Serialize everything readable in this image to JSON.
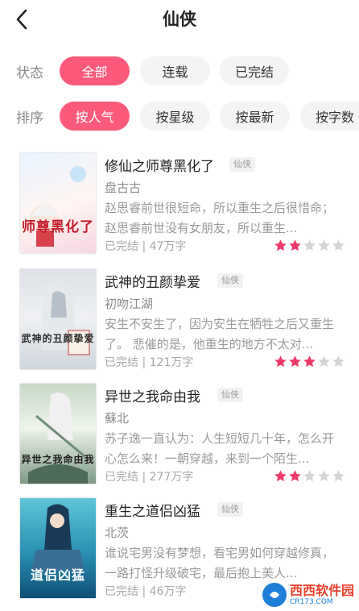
{
  "header": {
    "title": "仙侠"
  },
  "filters": {
    "status_label": "状态",
    "status_options": [
      "全部",
      "连载",
      "已完结"
    ],
    "sort_label": "排序",
    "sort_options": [
      "按人气",
      "按星级",
      "按最新",
      "按字数"
    ]
  },
  "books": [
    {
      "title": "修仙之师尊黑化了",
      "tag": "仙侠",
      "author": "盘古古",
      "description": "赵思睿前世很短命，所以重生之后很惜命；赵思睿前世没有女朋友，所以重生...",
      "status": "已完结",
      "word_count": "47万字",
      "rating": 2,
      "cover_text": "师尊黑化了"
    },
    {
      "title": "武神的丑颜挚爱",
      "tag": "仙侠",
      "author": "初吻江湖",
      "description": "安生不安生了，因为安生在牺牲之后又重生了。 悲催的是，他重生的地方不太对...",
      "status": "已完结",
      "word_count": "121万字",
      "rating": 3,
      "cover_text": "武神的丑颜挚爱"
    },
    {
      "title": "异世之我命由我",
      "tag": "仙侠",
      "author": "蘇北",
      "description": "苏子逸一直认为：人生短短几十年，怎么开心怎么来！一朝穿越，来到一个陌生...",
      "status": "已完结",
      "word_count": "277万字",
      "rating": 2,
      "cover_text": "异世之我命由我"
    },
    {
      "title": "重生之道侣凶猛",
      "tag": "仙侠",
      "author": "北茨",
      "description": "谁说宅男没有梦想，看宅男如何穿越修真，一路打怪升级破宅，最后抱上美人...",
      "status": "已完结",
      "word_count": "46万字",
      "rating": 2,
      "cover_text": "道侣凶猛"
    }
  ],
  "watermark": {
    "main": "西西软件园",
    "sub": "CR173.COM"
  },
  "colors": {
    "accent": "#fb5a7c",
    "star_on": "#ee3a6a",
    "star_off": "#d6d6d6"
  },
  "icons": {
    "back": "chevron-left-icon",
    "star": "star-icon"
  }
}
